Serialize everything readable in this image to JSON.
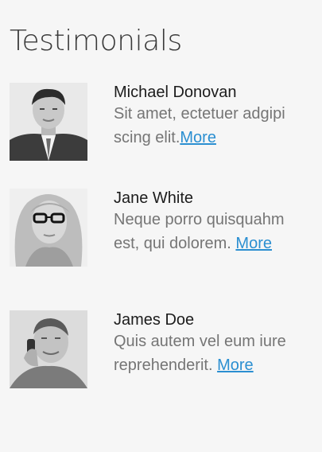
{
  "page": {
    "title": "Testimonials"
  },
  "testimonials": [
    {
      "name": "Michael Donovan",
      "text": "Sit amet, ectetuer adgipi scing elit.",
      "link": "More",
      "photo": "man-in-suit-avatar"
    },
    {
      "name": "Jane White",
      "text": "Neque porro quisquahm est, qui dolorem. ",
      "link": "More",
      "photo": "woman-with-glasses-avatar"
    },
    {
      "name": "James Doe",
      "text": "Quis autem vel eum iure reprehenderit. ",
      "link": "More",
      "photo": "man-on-phone-avatar"
    }
  ],
  "colors": {
    "background": "#f6f6f6",
    "link": "#2b8fd1",
    "name": "#1c1c1c",
    "text": "#757575"
  }
}
